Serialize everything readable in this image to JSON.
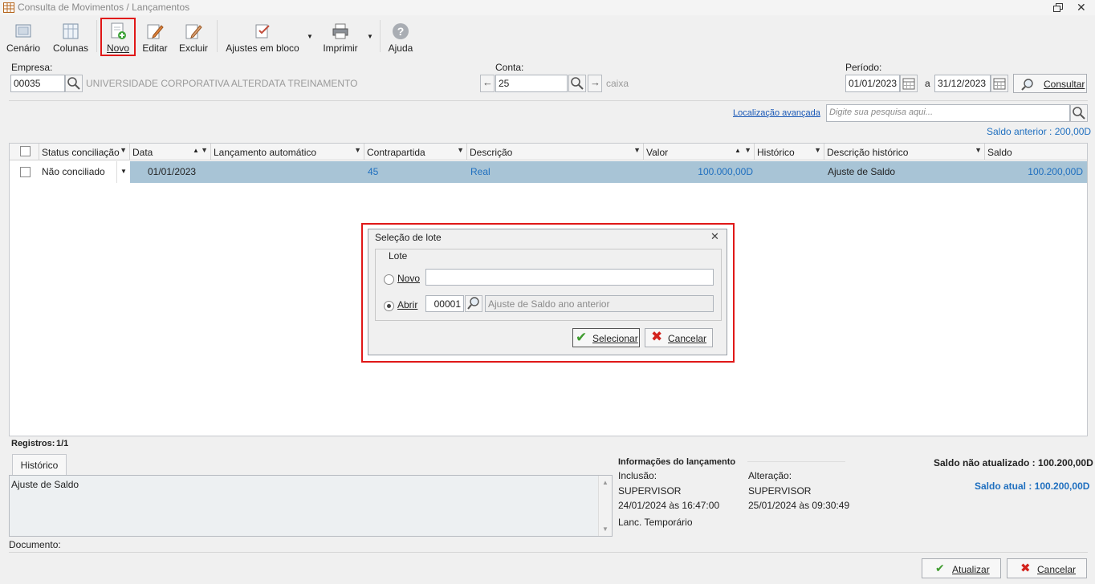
{
  "window": {
    "title": "Consulta de Movimentos / Lançamentos"
  },
  "toolbar": {
    "cenario": "Cenário",
    "colunas": "Colunas",
    "novo": "Novo",
    "editar": "Editar",
    "excluir": "Excluir",
    "ajustes": "Ajustes em bloco",
    "imprimir": "Imprimir",
    "ajuda": "Ajuda"
  },
  "form": {
    "empresa_label": "Empresa:",
    "empresa_code": "00035",
    "empresa_name": "UNIVERSIDADE CORPORATIVA ALTERDATA TREINAMENTO",
    "conta_label": "Conta:",
    "conta_code": "25",
    "conta_name": "caixa",
    "periodo_label": "Período:",
    "periodo_from": "01/01/2023",
    "periodo_sep": "a",
    "periodo_to": "31/12/2023",
    "consultar": "Consultar",
    "localizacao": "Localização avançada",
    "search_placeholder": "Digite sua pesquisa aqui...",
    "saldo_anterior": "Saldo anterior : 200,00D"
  },
  "grid": {
    "headers": {
      "status": "Status conciliação",
      "data": "Data",
      "lanc_auto": "Lançamento automático",
      "contrapartida": "Contrapartida",
      "descricao": "Descrição",
      "valor": "Valor",
      "historico": "Histórico",
      "desc_historico": "Descrição histórico",
      "saldo": "Saldo"
    },
    "rows": [
      {
        "status": "Não conciliado",
        "data": "01/01/2023",
        "lanc_auto": "",
        "contrapartida": "45",
        "descricao": "Real",
        "valor": "100.000,00D",
        "historico": "",
        "desc_historico": "Ajuste de Saldo",
        "saldo": "100.200,00D"
      }
    ]
  },
  "dialog": {
    "title": "Seleção de lote",
    "group": "Lote",
    "novo": "Novo",
    "novo_value": "",
    "abrir": "Abrir",
    "abrir_code": "00001",
    "abrir_desc": "Ajuste de Saldo ano anterior",
    "selecionar": "Selecionar",
    "cancelar": "Cancelar",
    "selected_option": "Abrir"
  },
  "footer": {
    "registros_label": "Registros:",
    "registros_value": "1/1",
    "tab_historico": "Histórico",
    "historico_text": "Ajuste de Saldo",
    "documento_label": "Documento:",
    "info_title": "Informações do lançamento",
    "inclusao_label": "Inclusão:",
    "inclusao_user": "SUPERVISOR",
    "inclusao_date": "24/01/2024 às 16:47:00",
    "alteracao_label": "Alteração:",
    "alteracao_user": "SUPERVISOR",
    "alteracao_date": "25/01/2024 às 09:30:49",
    "lanc_temp": "Lanc. Temporário",
    "saldo_nao_atualizado": "Saldo não atualizado : 100.200,00D",
    "saldo_atual": "Saldo atual : 100.200,00D",
    "atualizar": "Atualizar",
    "cancelar": "Cancelar"
  }
}
